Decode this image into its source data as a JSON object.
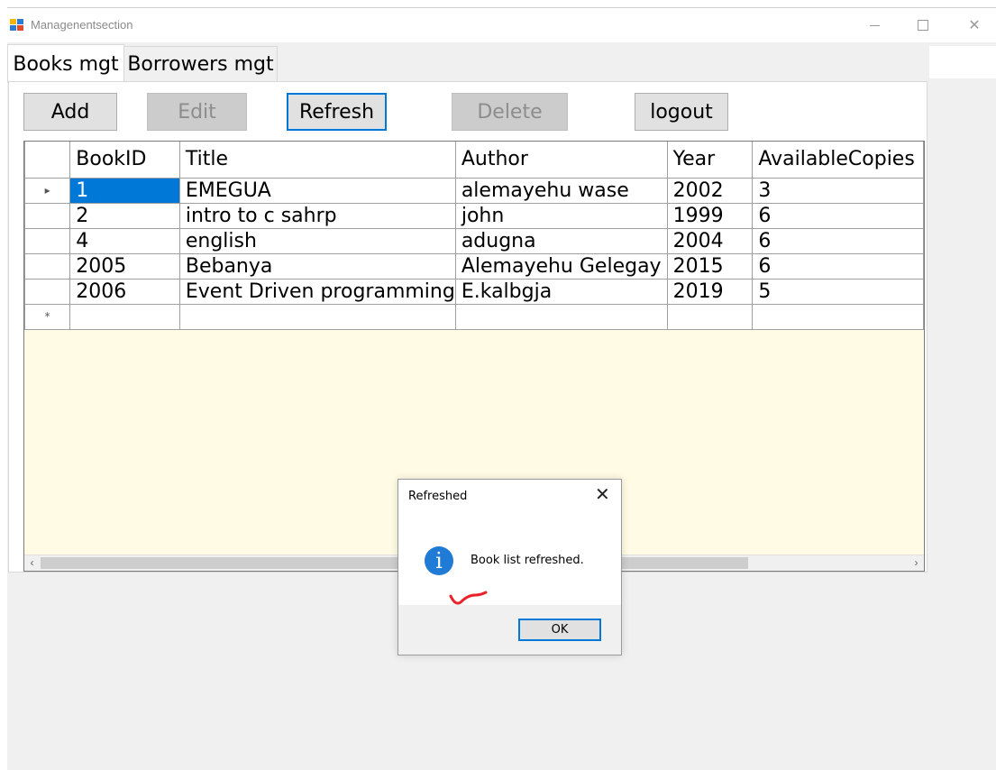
{
  "window": {
    "title": "Managenentsection"
  },
  "tabs": [
    {
      "label": "Books mgt",
      "active": true
    },
    {
      "label": "Borrowers mgt",
      "active": false
    }
  ],
  "toolbar": {
    "add": "Add",
    "edit": "Edit",
    "refresh": "Refresh",
    "delete": "Delete",
    "logout": "logout"
  },
  "grid": {
    "columns": [
      "BookID",
      "Title",
      "Author",
      "Year",
      "AvailableCopies"
    ],
    "rows": [
      [
        "1",
        "EMEGUA",
        "alemayehu wase",
        "2002",
        "3"
      ],
      [
        "2",
        "intro to c sahrp",
        "john",
        "1999",
        "6"
      ],
      [
        "4",
        "english",
        "adugna",
        "2004",
        "6"
      ],
      [
        "2005",
        "Bebanya",
        "Alemayehu Gelegay",
        "2015",
        "6"
      ],
      [
        "2006",
        "Event Driven programming",
        "E.kalbgja",
        "2019",
        "5"
      ]
    ],
    "current_row_marker": "▸",
    "new_row_marker": "*"
  },
  "dialog": {
    "title": "Refreshed",
    "message": "Book list refreshed.",
    "ok": "OK",
    "icon": "info-icon"
  },
  "colors": {
    "selection": "#0078d7",
    "grid_background": "#fffbe4",
    "focus_border": "#0078d7"
  }
}
